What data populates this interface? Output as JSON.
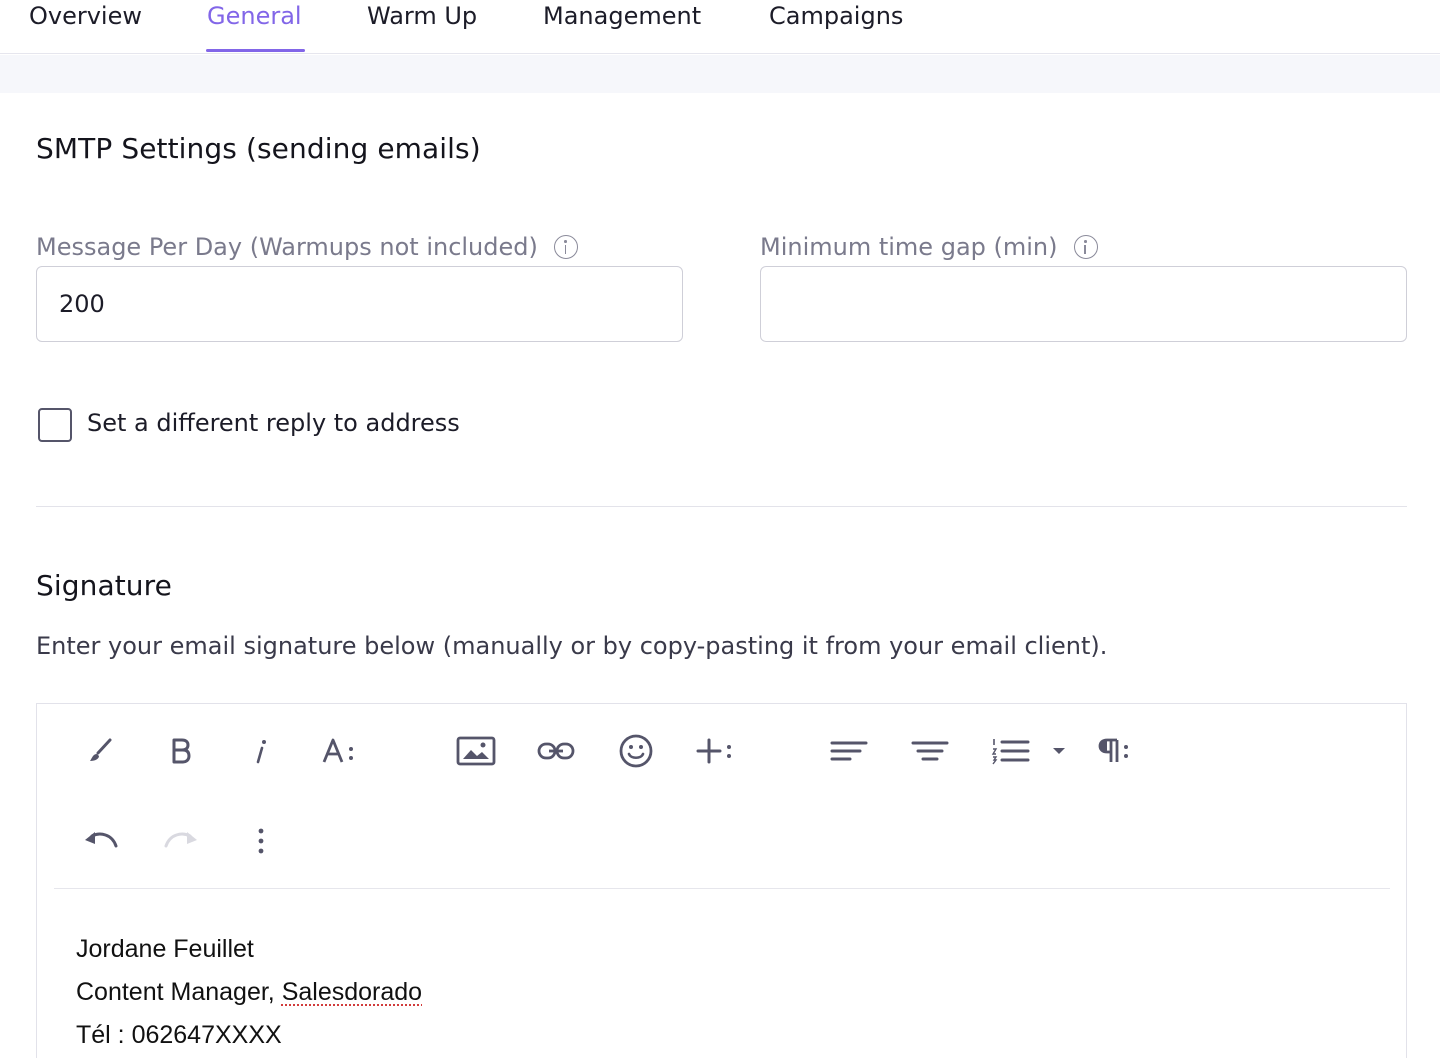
{
  "tabs": [
    {
      "label": "Overview",
      "active": false
    },
    {
      "label": "General",
      "active": true
    },
    {
      "label": "Warm Up",
      "active": false
    },
    {
      "label": "Management",
      "active": false
    },
    {
      "label": "Campaigns",
      "active": false
    }
  ],
  "smtp": {
    "title": "SMTP Settings (sending emails)",
    "messages_per_day": {
      "label": "Message Per Day (Warmups not included)",
      "value": "200",
      "info_icon": "info-icon"
    },
    "min_time_gap": {
      "label": "Minimum time gap (min)",
      "value": "",
      "info_icon": "info-icon"
    },
    "reply_to_checkbox": {
      "label": "Set a different reply to address",
      "checked": false
    }
  },
  "signature": {
    "title": "Signature",
    "description": "Enter your email signature below (manually or by copy-pasting it from your email client).",
    "toolbar_row1": [
      "paint-brush-icon",
      "bold-icon",
      "italic-icon",
      "font-size-icon",
      "image-icon",
      "link-icon",
      "emoji-icon",
      "insert-more-icon",
      "align-left-icon",
      "align-center-icon",
      "ordered-list-icon",
      "list-dropdown-icon",
      "paragraph-format-icon"
    ],
    "toolbar_row2": [
      "undo-icon",
      "redo-icon",
      "more-options-icon"
    ],
    "lines": {
      "name": "Jordane Feuillet",
      "role_prefix": "Content Manager, ",
      "company": "Salesdorado",
      "phone": "Tél : 062647XXXX"
    }
  },
  "colors": {
    "accent": "#8266e8",
    "label_gray": "#7a7a8c",
    "border": "#cfcfd8",
    "band": "#f6f7fb",
    "spellcheck": "#d23b3b"
  }
}
